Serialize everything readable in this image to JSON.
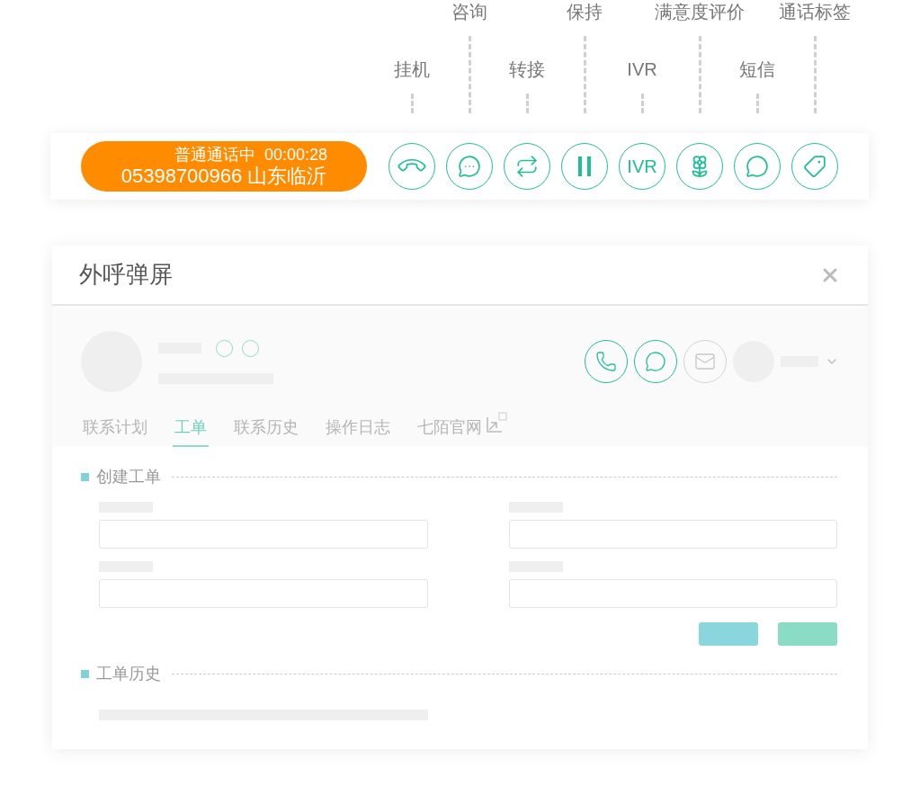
{
  "call_status": {
    "status": "普通通话中",
    "timer": "00:00:28",
    "number": "05398700966",
    "location": "山东临沂"
  },
  "actions": [
    {
      "label": "挂机",
      "kind": "hangup"
    },
    {
      "label": "咨询",
      "kind": "consult"
    },
    {
      "label": "转接",
      "kind": "transfer"
    },
    {
      "label": "保持",
      "kind": "hold"
    },
    {
      "label": "IVR",
      "kind": "text",
      "button_text": "IVR"
    },
    {
      "label": "满意度评价",
      "kind": "rating"
    },
    {
      "label": "短信",
      "kind": "sms"
    },
    {
      "label": "通话标签",
      "kind": "tag"
    }
  ],
  "dialog": {
    "title": "外呼弹屏",
    "contact_actions": [
      {
        "kind": "phone",
        "disabled": false
      },
      {
        "kind": "chat",
        "disabled": false
      },
      {
        "kind": "mail",
        "disabled": true
      }
    ],
    "tabs": [
      {
        "label": "联系计划",
        "selected": false,
        "external": false
      },
      {
        "label": "工单",
        "selected": true,
        "external": false
      },
      {
        "label": "联系历史",
        "selected": false,
        "external": false
      },
      {
        "label": "操作日志",
        "selected": false,
        "external": false
      },
      {
        "label": "七陌官网",
        "selected": false,
        "external": true
      }
    ],
    "sections": [
      {
        "title": "创建工单",
        "kind": "form"
      },
      {
        "title": "工单历史",
        "kind": "history"
      }
    ]
  }
}
